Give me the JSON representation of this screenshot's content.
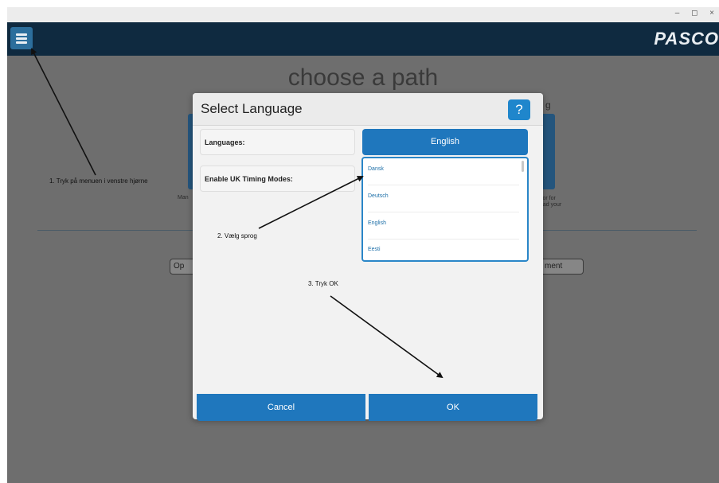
{
  "window": {
    "controls": "– ◻ ×"
  },
  "header": {
    "menu_icon": "hamburger-menu-icon",
    "logo": "PASCO"
  },
  "background": {
    "title": "choose a path",
    "left_text": "Man",
    "right_text_1": "sor for",
    "right_text_2": "oad your",
    "right_corner": "g",
    "left_button": "Op",
    "right_button": "ment"
  },
  "dialog": {
    "title": "Select Language",
    "help_label": "?",
    "languages_label": "Languages:",
    "uk_timing_label": "Enable UK Timing Modes:",
    "selected_language": "English",
    "options": [
      "Dansk",
      "Deutsch",
      "English",
      "Eesti"
    ],
    "cancel_label": "Cancel",
    "ok_label": "OK"
  },
  "annotations": {
    "step1": "1. Tryk på menuen i venstre hjørne",
    "step2": "2. Vælg sprog",
    "step3": "3. Tryk OK"
  },
  "colors": {
    "header": "#0f2a40",
    "accent": "#1f77bd",
    "overlay": "#6e6e6e"
  }
}
